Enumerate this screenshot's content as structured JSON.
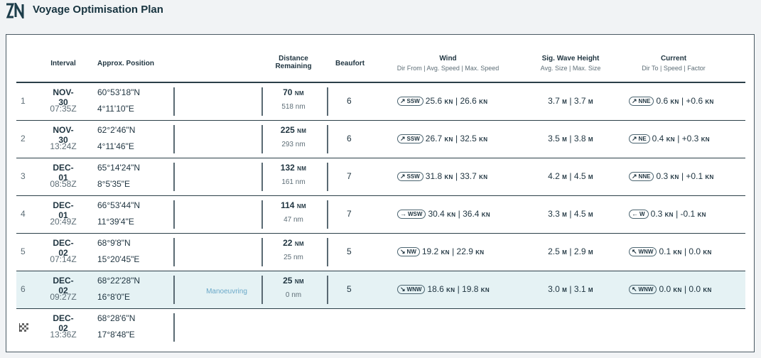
{
  "app": {
    "title": "Voyage Optimisation Plan",
    "logo_text": "ZN"
  },
  "headers": {
    "interval": "Interval",
    "position": "Approx. Position",
    "distance": "Distance",
    "distance2": "Remaining",
    "beaufort": "Beaufort",
    "wind": "Wind",
    "wind_sub": "Dir From | Avg. Speed | Max. Speed",
    "wave": "Sig. Wave Height",
    "wave_sub": "Avg. Size | Max. Size",
    "current": "Current",
    "current_sub": "Dir To | Speed | Factor"
  },
  "rows": [
    {
      "idx": "1",
      "date": "NOV-30",
      "time": "07:35Z",
      "lat": "60°53'18\"N",
      "lon": "4°11'10\"E",
      "note": "",
      "dist": "70",
      "dist_unit": "NM",
      "rem": "518 nm",
      "bft": "6",
      "wind_dir": "SSW",
      "wind_arrow": "↗",
      "wind_avg": "25.6",
      "wind_max": "26.6",
      "wave_avg": "3.7",
      "wave_max": "3.7",
      "cur_dir": "NNE",
      "cur_arrow": "↗",
      "cur_speed": "0.6",
      "cur_factor": "+0.6"
    },
    {
      "idx": "2",
      "date": "NOV-30",
      "time": "13:24Z",
      "lat": "62°2'46\"N",
      "lon": "4°11'46\"E",
      "note": "",
      "dist": "225",
      "dist_unit": "NM",
      "rem": "293 nm",
      "bft": "6",
      "wind_dir": "SSW",
      "wind_arrow": "↗",
      "wind_avg": "26.7",
      "wind_max": "32.5",
      "wave_avg": "3.5",
      "wave_max": "3.8",
      "cur_dir": "NE",
      "cur_arrow": "↗",
      "cur_speed": "0.4",
      "cur_factor": "+0.3"
    },
    {
      "idx": "3",
      "date": "DEC-01",
      "time": "08:58Z",
      "lat": "65°14'24\"N",
      "lon": "8°5'35\"E",
      "note": "",
      "dist": "132",
      "dist_unit": "NM",
      "rem": "161 nm",
      "bft": "7",
      "wind_dir": "SSW",
      "wind_arrow": "↗",
      "wind_avg": "31.8",
      "wind_max": "33.7",
      "wave_avg": "4.2",
      "wave_max": "4.5",
      "cur_dir": "NNE",
      "cur_arrow": "↗",
      "cur_speed": "0.3",
      "cur_factor": "+0.1"
    },
    {
      "idx": "4",
      "date": "DEC-01",
      "time": "20:49Z",
      "lat": "66°53'44\"N",
      "lon": "11°39'4\"E",
      "note": "",
      "dist": "114",
      "dist_unit": "NM",
      "rem": "47 nm",
      "bft": "7",
      "wind_dir": "WSW",
      "wind_arrow": "→",
      "wind_avg": "30.4",
      "wind_max": "36.4",
      "wave_avg": "3.3",
      "wave_max": "4.5",
      "cur_dir": "W",
      "cur_arrow": "←",
      "cur_speed": "0.3",
      "cur_factor": "-0.1"
    },
    {
      "idx": "5",
      "date": "DEC-02",
      "time": "07:14Z",
      "lat": "68°9'8\"N",
      "lon": "15°20'45\"E",
      "note": "",
      "dist": "22",
      "dist_unit": "NM",
      "rem": "25 nm",
      "bft": "5",
      "wind_dir": "NW",
      "wind_arrow": "↘",
      "wind_avg": "19.2",
      "wind_max": "22.9",
      "wave_avg": "2.5",
      "wave_max": "2.9",
      "cur_dir": "WNW",
      "cur_arrow": "↖",
      "cur_speed": "0.1",
      "cur_factor": "0.0"
    },
    {
      "idx": "6",
      "date": "DEC-02",
      "time": "09:27Z",
      "lat": "68°22'28\"N",
      "lon": "16°8'0\"E",
      "note": "Manoeuvring",
      "dist": "25",
      "dist_unit": "NM",
      "rem": "0 nm",
      "bft": "5",
      "wind_dir": "WNW",
      "wind_arrow": "↘",
      "wind_avg": "18.6",
      "wind_max": "19.8",
      "wave_avg": "3.0",
      "wave_max": "3.1",
      "cur_dir": "WNW",
      "cur_arrow": "↖",
      "cur_speed": "0.0",
      "cur_factor": "0.0"
    }
  ],
  "final": {
    "date": "DEC-02",
    "time": "13:36Z",
    "lat": "68°28'6\"N",
    "lon": "17°8'48\"E",
    "icon": "finish-flag-icon"
  },
  "units": {
    "kn": "KN",
    "m": "M"
  }
}
